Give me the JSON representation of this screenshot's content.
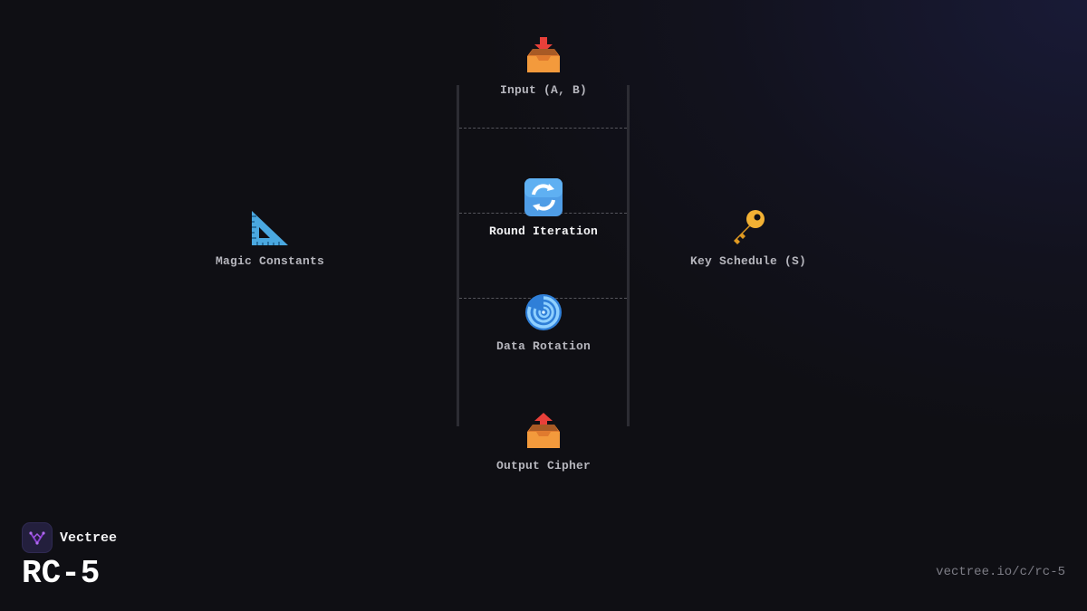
{
  "diagram": {
    "nodes": [
      {
        "id": "input",
        "label": "Input (A, B)",
        "icon": "inbox-in-icon"
      },
      {
        "id": "round",
        "label": "Round Iteration",
        "icon": "cycle-arrows-icon"
      },
      {
        "id": "rotation",
        "label": "Data Rotation",
        "icon": "cyclone-icon"
      },
      {
        "id": "output",
        "label": "Output Cipher",
        "icon": "outbox-icon"
      },
      {
        "id": "constants",
        "label": "Magic Constants",
        "icon": "triangle-ruler-icon"
      },
      {
        "id": "key",
        "label": "Key Schedule (S)",
        "icon": "key-icon"
      }
    ]
  },
  "brand": {
    "name": "Vectree",
    "icon": "vectree-logo-icon",
    "accent": "#8b3fd1"
  },
  "page": {
    "title": "RC-5",
    "url": "vectree.io/c/rc-5"
  },
  "colors": {
    "background": "#0f0f14",
    "rail": "#2c2c33",
    "divider": "#55555c"
  }
}
